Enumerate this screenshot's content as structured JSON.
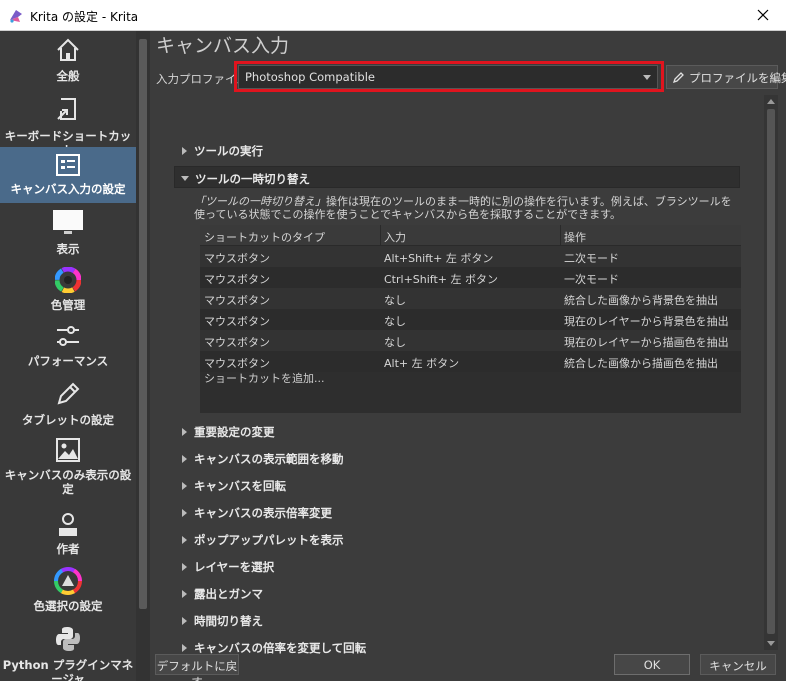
{
  "window": {
    "title": "Krita の設定 - Krita",
    "close_label": "閉じる"
  },
  "sidebar": {
    "items": [
      {
        "label": "全般",
        "icon": "home-icon"
      },
      {
        "label": "キーボードショートカット",
        "icon": "shortcut-icon"
      },
      {
        "label": "キャンバス入力の設定",
        "icon": "canvas-input-icon"
      },
      {
        "label": "表示",
        "icon": "display-icon"
      },
      {
        "label": "色管理",
        "icon": "color-wheel-icon"
      },
      {
        "label": "パフォーマンス",
        "icon": "performance-icon"
      },
      {
        "label": "タブレットの設定",
        "icon": "pen-icon"
      },
      {
        "label": "キャンバスのみ表示の設定",
        "icon": "image-icon"
      },
      {
        "label": "作者",
        "icon": "author-icon"
      },
      {
        "label": "色選択の設定",
        "icon": "color-selector-icon"
      },
      {
        "label": "Python プラグインマネージャ",
        "icon": "python-icon"
      }
    ]
  },
  "main": {
    "page_title": "キャンバス入力",
    "profile_label": "入力プロファイル",
    "profile_value": "Photoshop Compatible",
    "edit_profile_label": "プロファイルを編集",
    "sections_before": [
      {
        "label": "ツールの実行"
      }
    ],
    "open_section": {
      "label": "ツールの一時切り替え",
      "description_em": "「ツールの一時切り替え」",
      "description_rest": "操作は現在のツールのまま一時的に別の操作を行います。例えば、ブラシツールを使っている状態でこの操作を使うことでキャンバスから色を採取することができます。",
      "columns": [
        "ショートカットのタイプ",
        "入力",
        "操作"
      ],
      "rows": [
        [
          "マウスボタン",
          "Alt+Shift+ 左 ボタン",
          "二次モード"
        ],
        [
          "マウスボタン",
          "Ctrl+Shift+ 左 ボタン",
          "一次モード"
        ],
        [
          "マウスボタン",
          "なし",
          "統合した画像から背景色を抽出"
        ],
        [
          "マウスボタン",
          "なし",
          "現在のレイヤーから背景色を抽出"
        ],
        [
          "マウスボタン",
          "なし",
          "現在のレイヤーから描画色を抽出"
        ],
        [
          "マウスボタン",
          "Alt+ 左 ボタン",
          "統合した画像から描画色を抽出"
        ]
      ],
      "add_shortcut": "ショートカットを追加..."
    },
    "sections_after": [
      {
        "label": "重要設定の変更"
      },
      {
        "label": "キャンバスの表示範囲を移動"
      },
      {
        "label": "キャンバスを回転"
      },
      {
        "label": "キャンバスの表示倍率変更"
      },
      {
        "label": "ポップアップパレットを表示"
      },
      {
        "label": "レイヤーを選択"
      },
      {
        "label": "露出とガンマ"
      },
      {
        "label": "時間切り替え"
      },
      {
        "label": "キャンバスの倍率を変更して回転"
      }
    ]
  },
  "footer": {
    "restore_defaults": "デフォルトに戻す",
    "ok": "OK",
    "cancel": "キャンセル"
  },
  "colors": {
    "highlight_box": "#e0141e",
    "active_sidebar": "#4a6a8a"
  }
}
